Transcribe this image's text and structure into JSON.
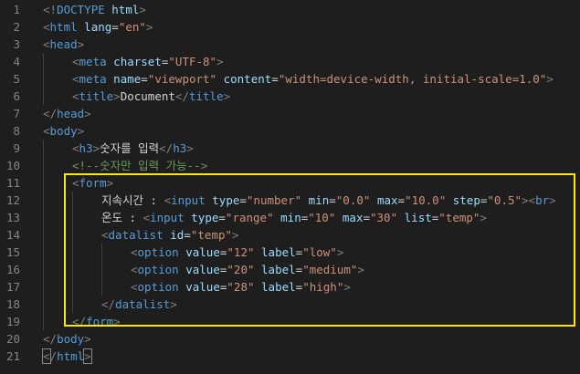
{
  "theme": {
    "background": "#1e1e1e",
    "line_number": "#858585",
    "tag_bracket": "#808080",
    "tag_name": "#569cd6",
    "attr_name": "#9cdcfe",
    "attr_value": "#ce9178",
    "text": "#d4d4d4",
    "comment": "#6a9955",
    "highlight": "#f5e614"
  },
  "lines": [
    {
      "n": "1",
      "indent": 0,
      "tokens": [
        {
          "t": "<!",
          "c": "tag_bracket"
        },
        {
          "t": "DOCTYPE",
          "c": "tag_name"
        },
        {
          "t": " ",
          "c": "text"
        },
        {
          "t": "html",
          "c": "attr_name"
        },
        {
          "t": ">",
          "c": "tag_bracket"
        }
      ]
    },
    {
      "n": "2",
      "indent": 0,
      "tokens": [
        {
          "t": "<",
          "c": "tag_bracket"
        },
        {
          "t": "html",
          "c": "tag_name"
        },
        {
          "t": " ",
          "c": "text"
        },
        {
          "t": "lang",
          "c": "attr_name"
        },
        {
          "t": "=",
          "c": "text"
        },
        {
          "t": "\"en\"",
          "c": "attr_value"
        },
        {
          "t": ">",
          "c": "tag_bracket"
        }
      ]
    },
    {
      "n": "3",
      "indent": 0,
      "tokens": [
        {
          "t": "<",
          "c": "tag_bracket"
        },
        {
          "t": "head",
          "c": "tag_name"
        },
        {
          "t": ">",
          "c": "tag_bracket"
        }
      ]
    },
    {
      "n": "4",
      "indent": 1,
      "tokens": [
        {
          "t": "<",
          "c": "tag_bracket"
        },
        {
          "t": "meta",
          "c": "tag_name"
        },
        {
          "t": " ",
          "c": "text"
        },
        {
          "t": "charset",
          "c": "attr_name"
        },
        {
          "t": "=",
          "c": "text"
        },
        {
          "t": "\"UTF-8\"",
          "c": "attr_value"
        },
        {
          "t": ">",
          "c": "tag_bracket"
        }
      ]
    },
    {
      "n": "5",
      "indent": 1,
      "tokens": [
        {
          "t": "<",
          "c": "tag_bracket"
        },
        {
          "t": "meta",
          "c": "tag_name"
        },
        {
          "t": " ",
          "c": "text"
        },
        {
          "t": "name",
          "c": "attr_name"
        },
        {
          "t": "=",
          "c": "text"
        },
        {
          "t": "\"viewport\"",
          "c": "attr_value"
        },
        {
          "t": " ",
          "c": "text"
        },
        {
          "t": "content",
          "c": "attr_name"
        },
        {
          "t": "=",
          "c": "text"
        },
        {
          "t": "\"width=device-width, initial-scale=1.0\"",
          "c": "attr_value"
        },
        {
          "t": ">",
          "c": "tag_bracket"
        }
      ]
    },
    {
      "n": "6",
      "indent": 1,
      "tokens": [
        {
          "t": "<",
          "c": "tag_bracket"
        },
        {
          "t": "title",
          "c": "tag_name"
        },
        {
          "t": ">",
          "c": "tag_bracket"
        },
        {
          "t": "Document",
          "c": "text"
        },
        {
          "t": "</",
          "c": "tag_bracket"
        },
        {
          "t": "title",
          "c": "tag_name"
        },
        {
          "t": ">",
          "c": "tag_bracket"
        }
      ]
    },
    {
      "n": "7",
      "indent": 0,
      "tokens": [
        {
          "t": "</",
          "c": "tag_bracket"
        },
        {
          "t": "head",
          "c": "tag_name"
        },
        {
          "t": ">",
          "c": "tag_bracket"
        }
      ]
    },
    {
      "n": "8",
      "indent": 0,
      "tokens": [
        {
          "t": "<",
          "c": "tag_bracket"
        },
        {
          "t": "body",
          "c": "tag_name"
        },
        {
          "t": ">",
          "c": "tag_bracket"
        }
      ]
    },
    {
      "n": "9",
      "indent": 1,
      "tokens": [
        {
          "t": "<",
          "c": "tag_bracket"
        },
        {
          "t": "h3",
          "c": "tag_name"
        },
        {
          "t": ">",
          "c": "tag_bracket"
        },
        {
          "t": "숫자를 입력",
          "c": "text"
        },
        {
          "t": "</",
          "c": "tag_bracket"
        },
        {
          "t": "h3",
          "c": "tag_name"
        },
        {
          "t": ">",
          "c": "tag_bracket"
        }
      ]
    },
    {
      "n": "10",
      "indent": 1,
      "tokens": [
        {
          "t": "<!--숫자만 입력 가능-->",
          "c": "comment"
        }
      ]
    },
    {
      "n": "11",
      "indent": 1,
      "tokens": [
        {
          "t": "<",
          "c": "tag_bracket"
        },
        {
          "t": "form",
          "c": "tag_name"
        },
        {
          "t": ">",
          "c": "tag_bracket"
        }
      ]
    },
    {
      "n": "12",
      "indent": 2,
      "tokens": [
        {
          "t": "지속시간 : ",
          "c": "text"
        },
        {
          "t": "<",
          "c": "tag_bracket"
        },
        {
          "t": "input",
          "c": "tag_name"
        },
        {
          "t": " ",
          "c": "text"
        },
        {
          "t": "type",
          "c": "attr_name"
        },
        {
          "t": "=",
          "c": "text"
        },
        {
          "t": "\"number\"",
          "c": "attr_value"
        },
        {
          "t": " ",
          "c": "text"
        },
        {
          "t": "min",
          "c": "attr_name"
        },
        {
          "t": "=",
          "c": "text"
        },
        {
          "t": "\"0.0\"",
          "c": "attr_value"
        },
        {
          "t": " ",
          "c": "text"
        },
        {
          "t": "max",
          "c": "attr_name"
        },
        {
          "t": "=",
          "c": "text"
        },
        {
          "t": "\"10.0\"",
          "c": "attr_value"
        },
        {
          "t": " ",
          "c": "text"
        },
        {
          "t": "step",
          "c": "attr_name"
        },
        {
          "t": "=",
          "c": "text"
        },
        {
          "t": "\"0.5\"",
          "c": "attr_value"
        },
        {
          "t": ">",
          "c": "tag_bracket"
        },
        {
          "t": "<",
          "c": "tag_bracket"
        },
        {
          "t": "br",
          "c": "tag_name"
        },
        {
          "t": ">",
          "c": "tag_bracket"
        }
      ]
    },
    {
      "n": "13",
      "indent": 2,
      "tokens": [
        {
          "t": "온도 : ",
          "c": "text"
        },
        {
          "t": "<",
          "c": "tag_bracket"
        },
        {
          "t": "input",
          "c": "tag_name"
        },
        {
          "t": " ",
          "c": "text"
        },
        {
          "t": "type",
          "c": "attr_name"
        },
        {
          "t": "=",
          "c": "text"
        },
        {
          "t": "\"range\"",
          "c": "attr_value"
        },
        {
          "t": " ",
          "c": "text"
        },
        {
          "t": "min",
          "c": "attr_name"
        },
        {
          "t": "=",
          "c": "text"
        },
        {
          "t": "\"10\"",
          "c": "attr_value"
        },
        {
          "t": " ",
          "c": "text"
        },
        {
          "t": "max",
          "c": "attr_name"
        },
        {
          "t": "=",
          "c": "text"
        },
        {
          "t": "\"30\"",
          "c": "attr_value"
        },
        {
          "t": " ",
          "c": "text"
        },
        {
          "t": "list",
          "c": "attr_name"
        },
        {
          "t": "=",
          "c": "text"
        },
        {
          "t": "\"temp\"",
          "c": "attr_value"
        },
        {
          "t": ">",
          "c": "tag_bracket"
        }
      ]
    },
    {
      "n": "14",
      "indent": 2,
      "tokens": [
        {
          "t": "<",
          "c": "tag_bracket"
        },
        {
          "t": "datalist",
          "c": "tag_name"
        },
        {
          "t": " ",
          "c": "text"
        },
        {
          "t": "id",
          "c": "attr_name"
        },
        {
          "t": "=",
          "c": "text"
        },
        {
          "t": "\"temp\"",
          "c": "attr_value"
        },
        {
          "t": ">",
          "c": "tag_bracket"
        }
      ]
    },
    {
      "n": "15",
      "indent": 3,
      "tokens": [
        {
          "t": "<",
          "c": "tag_bracket"
        },
        {
          "t": "option",
          "c": "tag_name"
        },
        {
          "t": " ",
          "c": "text"
        },
        {
          "t": "value",
          "c": "attr_name"
        },
        {
          "t": "=",
          "c": "text"
        },
        {
          "t": "\"12\"",
          "c": "attr_value"
        },
        {
          "t": " ",
          "c": "text"
        },
        {
          "t": "label",
          "c": "attr_name"
        },
        {
          "t": "=",
          "c": "text"
        },
        {
          "t": "\"low\"",
          "c": "attr_value"
        },
        {
          "t": ">",
          "c": "tag_bracket"
        }
      ]
    },
    {
      "n": "16",
      "indent": 3,
      "tokens": [
        {
          "t": "<",
          "c": "tag_bracket"
        },
        {
          "t": "option",
          "c": "tag_name"
        },
        {
          "t": " ",
          "c": "text"
        },
        {
          "t": "value",
          "c": "attr_name"
        },
        {
          "t": "=",
          "c": "text"
        },
        {
          "t": "\"20\"",
          "c": "attr_value"
        },
        {
          "t": " ",
          "c": "text"
        },
        {
          "t": "label",
          "c": "attr_name"
        },
        {
          "t": "=",
          "c": "text"
        },
        {
          "t": "\"medium\"",
          "c": "attr_value"
        },
        {
          "t": ">",
          "c": "tag_bracket"
        }
      ]
    },
    {
      "n": "17",
      "indent": 3,
      "tokens": [
        {
          "t": "<",
          "c": "tag_bracket"
        },
        {
          "t": "option",
          "c": "tag_name"
        },
        {
          "t": " ",
          "c": "text"
        },
        {
          "t": "value",
          "c": "attr_name"
        },
        {
          "t": "=",
          "c": "text"
        },
        {
          "t": "\"28\"",
          "c": "attr_value"
        },
        {
          "t": " ",
          "c": "text"
        },
        {
          "t": "label",
          "c": "attr_name"
        },
        {
          "t": "=",
          "c": "text"
        },
        {
          "t": "\"high\"",
          "c": "attr_value"
        },
        {
          "t": ">",
          "c": "tag_bracket"
        }
      ]
    },
    {
      "n": "18",
      "indent": 2,
      "tokens": [
        {
          "t": "</",
          "c": "tag_bracket"
        },
        {
          "t": "datalist",
          "c": "tag_name"
        },
        {
          "t": ">",
          "c": "tag_bracket"
        }
      ]
    },
    {
      "n": "19",
      "indent": 1,
      "tokens": [
        {
          "t": "</",
          "c": "tag_bracket"
        },
        {
          "t": "form",
          "c": "tag_name"
        },
        {
          "t": ">",
          "c": "tag_bracket"
        }
      ]
    },
    {
      "n": "20",
      "indent": 0,
      "tokens": [
        {
          "t": "</",
          "c": "tag_bracket"
        },
        {
          "t": "body",
          "c": "tag_name"
        },
        {
          "t": ">",
          "c": "tag_bracket"
        }
      ]
    },
    {
      "n": "21",
      "indent": 0,
      "tokens": [
        {
          "t": "<",
          "c": "tag_bracket",
          "box": true
        },
        {
          "t": "/",
          "c": "tag_bracket"
        },
        {
          "t": "html",
          "c": "tag_name"
        },
        {
          "t": ">",
          "c": "tag_bracket",
          "box": true
        }
      ]
    }
  ]
}
